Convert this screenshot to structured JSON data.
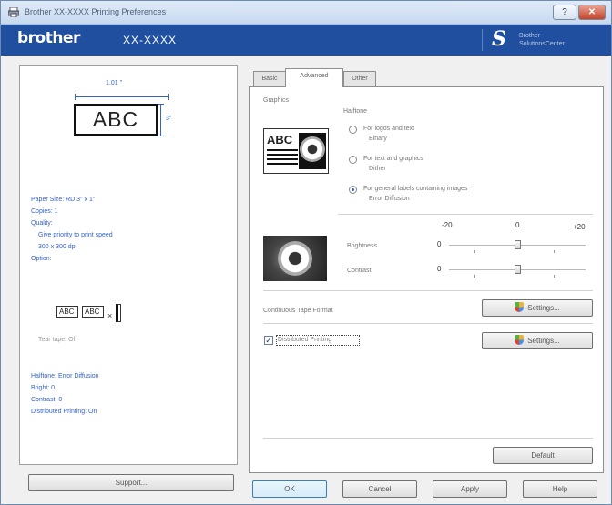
{
  "window": {
    "title": "Brother XX-XXXX Printing Preferences",
    "help_label": "?",
    "close_label": "✕"
  },
  "brand": {
    "logo": "brother",
    "model": "XX-XXXX",
    "solutions_line1": "Brother",
    "solutions_line2": "SolutionsCenter"
  },
  "preview": {
    "width_dim": "1.01 \"",
    "height_dim": "3\"",
    "label_text": "ABC",
    "info": [
      "Paper Size: RD 3\" x 1\"",
      "Copies: 1",
      "Quality:",
      "Give priority to print speed",
      "300 x 300 dpi",
      "Option:"
    ],
    "mini_a": "ABC",
    "mini_b": "ABC",
    "mini_x": "×",
    "tear_text": "Tear tape: Off",
    "info2": [
      "Halftone: Error Diffusion",
      "Bright: 0",
      "Contrast: 0",
      "Distributed Printing: On"
    ],
    "support_label": "Support..."
  },
  "tabs": [
    "Basic",
    "Advanced",
    "Other"
  ],
  "advanced": {
    "graphics_label": "Graphics",
    "halftone_label": "Halftone",
    "options": [
      {
        "line1": "For logos and text",
        "line2": "Binary",
        "selected": false
      },
      {
        "line1": "For text and graphics",
        "line2": "Dither",
        "selected": false
      },
      {
        "line1": "For general labels containing images",
        "line2": "Error Diffusion",
        "selected": true
      }
    ],
    "abc_text": "ABC",
    "scale_min": "-20",
    "scale_mid": "0",
    "scale_max": "+20",
    "brightness_label": "Brightness",
    "brightness_value": "0",
    "contrast_label": "Contrast",
    "contrast_value": "0",
    "continuous_tape_label": "Continuous Tape Format",
    "settings_label": "Settings...",
    "distributed_label": "Distributed Printing",
    "distributed_checked": "✓",
    "default_label": "Default"
  },
  "footer": {
    "ok": "OK",
    "cancel": "Cancel",
    "apply": "Apply",
    "help": "Help"
  }
}
